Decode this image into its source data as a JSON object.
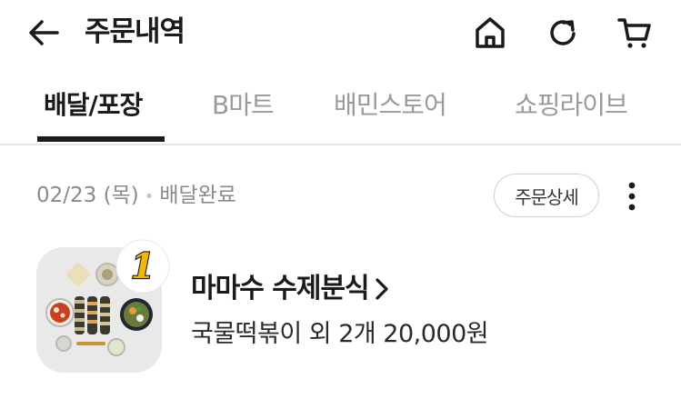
{
  "header": {
    "title": "주문내역",
    "icons": [
      "back-arrow-icon",
      "home-icon",
      "refresh-icon",
      "cart-icon"
    ]
  },
  "tabs": [
    {
      "label": "배달/포장",
      "active": true
    },
    {
      "label": "B마트",
      "active": false
    },
    {
      "label": "배민스토어",
      "active": false
    },
    {
      "label": "쇼핑라이브",
      "active": false
    }
  ],
  "order": {
    "date": "02/23 (목)",
    "status": "배달완료",
    "detail_label": "주문상세",
    "badge_number": "1",
    "store_name": "마마수 수제분식",
    "summary": "국물떡볶이 외 2개 20,000원"
  },
  "colors": {
    "text": "#1a1a1a",
    "muted": "#9a9a9a",
    "badge": "#f2b705"
  }
}
